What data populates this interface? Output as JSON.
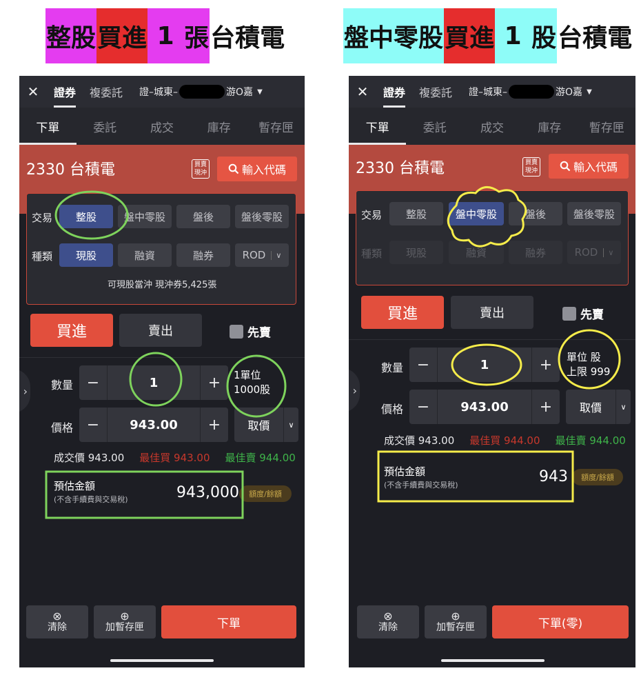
{
  "captions": {
    "left": [
      "整股",
      "買進",
      " 1 ",
      "張",
      "台積電"
    ],
    "right": [
      "盤中零股",
      "買進",
      " 1 ",
      "股",
      "台積電"
    ]
  },
  "colors": {
    "highlight_magenta": "#e43cf0",
    "highlight_red": "#e52d2d",
    "highlight_cyan": "#8efcf8",
    "buy_red": "#e24f3d",
    "best_bid": "#c7382c",
    "best_ask": "#3fb44a",
    "annot_green": "#7ed35c",
    "annot_yellow": "#f5ec4a"
  },
  "left": {
    "topbar": {
      "close": "✕",
      "tab1": "證券",
      "tab2": "複委託",
      "account_pre": "證–城東–",
      "account_post": "游O嘉",
      "caret": "▼"
    },
    "subtabs": [
      "下單",
      "委託",
      "成交",
      "庫存",
      "暫存匣"
    ],
    "stock": "2330 台積電",
    "tag": [
      "買賣",
      "現沖"
    ],
    "search": "輸入代碼",
    "trade_label": "交易",
    "trade_opts": [
      "整股",
      "盤中零股",
      "盤後",
      "盤後零股"
    ],
    "type_label": "種類",
    "type_opts": [
      "現股",
      "融資",
      "融券",
      "ROD"
    ],
    "note": "可現股當沖 現沖券5,425張",
    "buy": "買進",
    "sell": "賣出",
    "first_sell": "先賣",
    "qty_label": "數量",
    "qty": "1",
    "unit1": "1單位",
    "unit2": "1000股",
    "price_label": "價格",
    "price": "943.00",
    "price_btn": "取價",
    "last": "成交價 943.00",
    "best_bid": "最佳買 943.00",
    "best_ask": "最佳賣 944.00",
    "est_label": "預估金額",
    "est_sub": "(不含手續費與交易稅)",
    "est_val": "943,000",
    "quota": "額度/餘額",
    "clear": "清除",
    "save": "加暫存匣",
    "order": "下單"
  },
  "right": {
    "topbar": {
      "close": "✕",
      "tab1": "證券",
      "tab2": "複委託",
      "account_pre": "證–城東–",
      "account_post": "游O嘉",
      "caret": "▼"
    },
    "subtabs": [
      "下單",
      "委託",
      "成交",
      "庫存",
      "暫存匣"
    ],
    "stock": "2330 台積電",
    "tag": [
      "買賣",
      "現沖"
    ],
    "search": "輸入代碼",
    "trade_label": "交易",
    "trade_opts": [
      "整股",
      "盤中零股",
      "盤後",
      "盤後零股"
    ],
    "type_label": "種類",
    "type_opts": [
      "現股",
      "融資",
      "融券",
      "ROD"
    ],
    "buy": "買進",
    "sell": "賣出",
    "first_sell": "先賣",
    "qty_label": "數量",
    "qty": "1",
    "unit1": "單位 股",
    "unit2": "上限 999",
    "price_label": "價格",
    "price": "943.00",
    "price_btn": "取價",
    "last": "成交價 943.00",
    "best_bid": "最佳買 944.00",
    "best_ask": "最佳賣 944.00",
    "est_label": "預估金額",
    "est_sub": "(不含手續費與交易稅)",
    "est_val": "943",
    "quota": "額度/餘額",
    "clear": "清除",
    "save": "加暫存匣",
    "order": "下單(零)"
  },
  "icons": {
    "search": "search-icon",
    "clear": "clear-circle-icon",
    "add": "plus-circle-icon",
    "chevron": "chevron-right-icon",
    "dropdown": "chevron-down-icon"
  }
}
